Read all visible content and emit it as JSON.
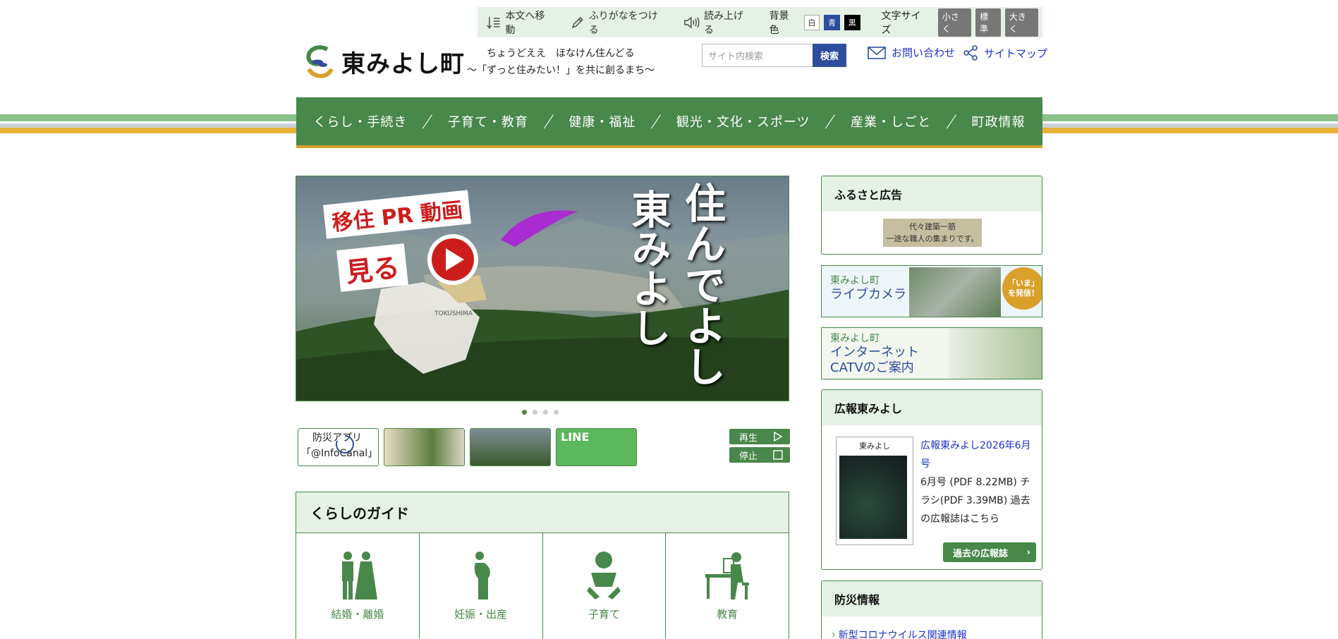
{
  "util": {
    "skip_label": "本文へ移動",
    "furigana_label": "ふりがなをつける",
    "read_label": "読み上げる",
    "bg_label": "背景色",
    "bg_white": "白",
    "bg_blue": "青",
    "bg_black": "黒",
    "font_label": "文字サイズ",
    "font_small": "小さく",
    "font_normal": "標準",
    "font_large": "大きく"
  },
  "header": {
    "logo_name": "東みよし町",
    "tagline1": "ちょうどええ　ほなけん住んどる",
    "tagline2": "～「ずっと住みたい！」を共に創るまち～",
    "search_placeholder": "サイト内検索",
    "search_button": "検索",
    "contact": "お問い合わせ",
    "sitemap": "サイトマップ"
  },
  "colors": {
    "brand_green": "#48884a",
    "light_green": "#e4f1e4",
    "gold": "#d9a02a",
    "link_blue": "#1a33c4",
    "search_blue": "#2e4d9c"
  },
  "nav": {
    "items": [
      "くらし・手続き",
      "子育て・教育",
      "健康・福祉",
      "観光・文化・スポーツ",
      "産業・しごと",
      "町政情報"
    ]
  },
  "hero": {
    "pr_text": "移住 PR 動画",
    "watch_text": "見る",
    "vertical_col1": "住んでよし",
    "vertical_col2": "東みよし",
    "map_label": "TOKUSHIMA"
  },
  "slider": {
    "thumb1_alt_line1": "防災アプリ",
    "thumb1_alt_line2": "「@InfoCanal」",
    "thumb4_text": "LINE",
    "play_label": "再生",
    "stop_label": "停止"
  },
  "guide": {
    "title": "くらしのガイド",
    "items": [
      {
        "label": "結婚・離婚",
        "icon": "wedding-couple-icon"
      },
      {
        "label": "妊娠・出産",
        "icon": "pregnancy-icon"
      },
      {
        "label": "子育て",
        "icon": "baby-icon"
      },
      {
        "label": "教育",
        "icon": "desk-study-icon"
      }
    ]
  },
  "sidebar": {
    "furusato_title": "ふるさと広告",
    "furusato_ad_line1": "代々建築一筋",
    "furusato_ad_line2": "一途な職人の集まりです。",
    "livecam_small": "東みよし町",
    "livecam_big": "ライブカメラ",
    "livecam_badge": "「いま」を発信！",
    "catv_small": "東みよし町",
    "catv_big1": "インターネット",
    "catv_big2": "CATVのご案内",
    "koho_title": "広報東みよし",
    "koho_link": "広報東みよし2026年6月号",
    "koho_desc": "6月号 (PDF 8.22MB) チラシ(PDF 3.39MB) 過去の広報誌はこちら",
    "koho_cover_title": "東みよし",
    "koho_button": "過去の広報誌",
    "bousai_title": "防災情報",
    "bousai_link": "新型コロナウイルス関連情報"
  }
}
